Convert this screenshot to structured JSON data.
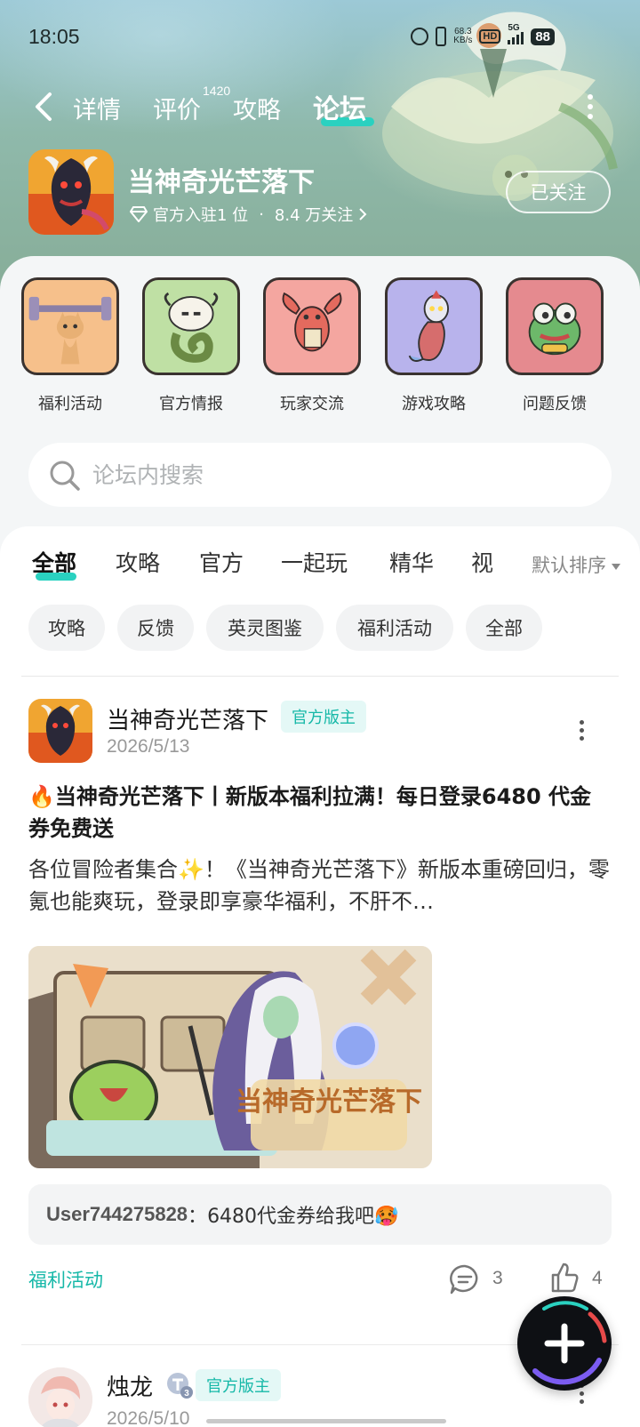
{
  "status_bar": {
    "time": "18:05",
    "net_speed_value": "68.3",
    "net_speed_unit": "KB/s",
    "hd": "HD",
    "network": "5G",
    "battery": "88"
  },
  "nav": {
    "tabs": [
      {
        "label": "详情"
      },
      {
        "label": "评价",
        "count": "1420"
      },
      {
        "label": "攻略"
      },
      {
        "label": "论坛",
        "active": true
      }
    ]
  },
  "game": {
    "title": "当神奇光芒落下",
    "official_text": "官方入驻1 位",
    "separator": "·",
    "followers": "8.4 万关注",
    "follow_button": "已关注"
  },
  "categories": [
    {
      "label": "福利活动",
      "icon": "weightlifting-cat-icon",
      "color": "#f6c08b"
    },
    {
      "label": "官方情报",
      "icon": "cow-snake-icon",
      "color": "#bfe0a4"
    },
    {
      "label": "玩家交流",
      "icon": "crayfish-icon",
      "color": "#f4a6a0"
    },
    {
      "label": "游戏攻略",
      "icon": "hero-fish-icon",
      "color": "#b8b3ec"
    },
    {
      "label": "问题反馈",
      "icon": "frog-icon",
      "color": "#e58a8f"
    }
  ],
  "search": {
    "placeholder": "论坛内搜索"
  },
  "feed_tabs": [
    {
      "label": "全部",
      "active": true
    },
    {
      "label": "攻略"
    },
    {
      "label": "官方"
    },
    {
      "label": "一起玩"
    },
    {
      "label": "精华"
    },
    {
      "label": "视"
    }
  ],
  "sort": {
    "label": "默认排序"
  },
  "chips": [
    "攻略",
    "反馈",
    "英灵图鉴",
    "福利活动",
    "全部"
  ],
  "post1": {
    "author": "当神奇光芒落下",
    "badge": "官方版主",
    "date": "2026/5/13",
    "title": "🔥当神奇光芒落下丨新版本福利拉满！每日登录6480 代金券免费送",
    "body": "各位冒险者集合✨！《当神奇光芒落下》新版本重磅回归，零氪也能爽玩，登录即享豪华福利，不肝不…",
    "image_text": "当神奇光芒落下",
    "comment_user": "User744275828",
    "comment_sep": "：",
    "comment_text": "6480代金券给我吧🥵",
    "tag": "福利活动",
    "comments": "3",
    "likes": "4"
  },
  "post2": {
    "author": "烛龙",
    "level": "3",
    "badge": "官方版主",
    "date": "2026/5/10"
  },
  "colors": {
    "accent": "#2ad1c0",
    "tag_text": "#16b8a8",
    "badge_bg": "#e4f8f6"
  }
}
